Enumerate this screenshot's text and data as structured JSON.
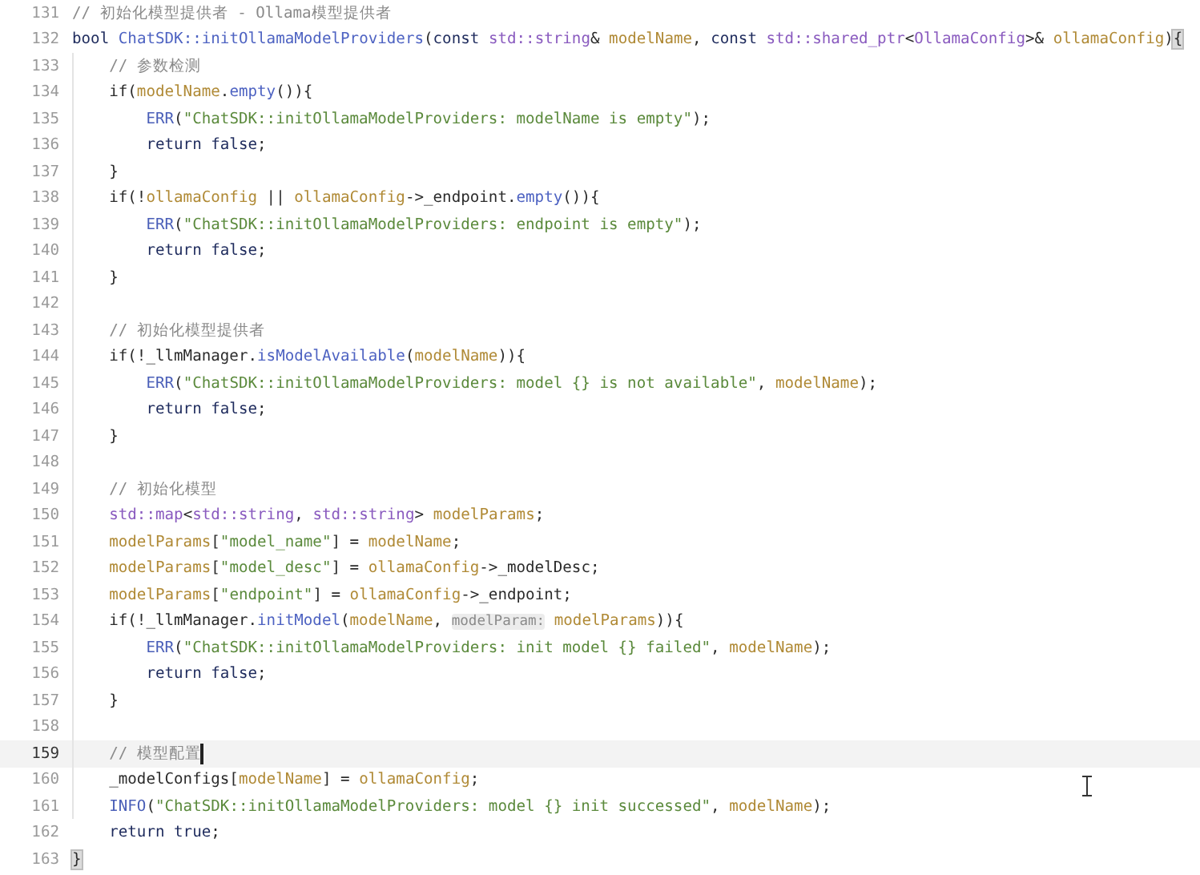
{
  "editor": {
    "lines": [
      {
        "number": "131",
        "current": false,
        "tokens": [
          {
            "kind": "comment",
            "text": "// 初始化模型提供者 - Ollama模型提供者"
          }
        ]
      },
      {
        "number": "132",
        "current": false,
        "tokens": [
          {
            "kind": "keyword",
            "text": "bool "
          },
          {
            "kind": "function",
            "text": "ChatSDK::initOllamaModelProviders"
          },
          {
            "kind": "plain",
            "text": "("
          },
          {
            "kind": "keyword",
            "text": "const "
          },
          {
            "kind": "type",
            "text": "std::string"
          },
          {
            "kind": "plain",
            "text": "& "
          },
          {
            "kind": "variable",
            "text": "modelName"
          },
          {
            "kind": "plain",
            "text": ", "
          },
          {
            "kind": "keyword",
            "text": "const "
          },
          {
            "kind": "type",
            "text": "std::shared_ptr"
          },
          {
            "kind": "plain",
            "text": "<"
          },
          {
            "kind": "type",
            "text": "OllamaConfig"
          },
          {
            "kind": "plain",
            "text": ">& "
          },
          {
            "kind": "variable",
            "text": "ollamaConfig"
          },
          {
            "kind": "plain",
            "text": ")"
          },
          {
            "kind": "match",
            "text": "{"
          }
        ]
      },
      {
        "number": "133",
        "current": false,
        "tokens": [
          {
            "kind": "comment",
            "text": "    // 参数检测"
          }
        ]
      },
      {
        "number": "134",
        "current": false,
        "tokens": [
          {
            "kind": "plain",
            "text": "    if("
          },
          {
            "kind": "variable",
            "text": "modelName"
          },
          {
            "kind": "plain",
            "text": "."
          },
          {
            "kind": "function",
            "text": "empty"
          },
          {
            "kind": "plain",
            "text": "()){"
          }
        ]
      },
      {
        "number": "135",
        "current": false,
        "tokens": [
          {
            "kind": "macro",
            "text": "        ERR"
          },
          {
            "kind": "plain",
            "text": "("
          },
          {
            "kind": "string",
            "text": "\"ChatSDK::initOllamaModelProviders: modelName is empty\""
          },
          {
            "kind": "plain",
            "text": ");"
          }
        ]
      },
      {
        "number": "136",
        "current": false,
        "tokens": [
          {
            "kind": "keyword",
            "text": "        return false"
          },
          {
            "kind": "plain",
            "text": ";"
          }
        ]
      },
      {
        "number": "137",
        "current": false,
        "tokens": [
          {
            "kind": "plain",
            "text": "    }"
          }
        ]
      },
      {
        "number": "138",
        "current": false,
        "tokens": [
          {
            "kind": "plain",
            "text": "    if(!"
          },
          {
            "kind": "variable",
            "text": "ollamaConfig"
          },
          {
            "kind": "plain",
            "text": " || "
          },
          {
            "kind": "variable",
            "text": "ollamaConfig"
          },
          {
            "kind": "plain",
            "text": "->_endpoint."
          },
          {
            "kind": "function",
            "text": "empty"
          },
          {
            "kind": "plain",
            "text": "()){"
          }
        ]
      },
      {
        "number": "139",
        "current": false,
        "tokens": [
          {
            "kind": "macro",
            "text": "        ERR"
          },
          {
            "kind": "plain",
            "text": "("
          },
          {
            "kind": "string",
            "text": "\"ChatSDK::initOllamaModelProviders: endpoint is empty\""
          },
          {
            "kind": "plain",
            "text": ");"
          }
        ]
      },
      {
        "number": "140",
        "current": false,
        "tokens": [
          {
            "kind": "keyword",
            "text": "        return false"
          },
          {
            "kind": "plain",
            "text": ";"
          }
        ]
      },
      {
        "number": "141",
        "current": false,
        "tokens": [
          {
            "kind": "plain",
            "text": "    }"
          }
        ]
      },
      {
        "number": "142",
        "current": false
      },
      {
        "number": "143",
        "current": false,
        "tokens": [
          {
            "kind": "comment",
            "text": "    // 初始化模型提供者"
          }
        ]
      },
      {
        "number": "144",
        "current": false,
        "tokens": [
          {
            "kind": "plain",
            "text": "    if(!_llmManager."
          },
          {
            "kind": "function",
            "text": "isModelAvailable"
          },
          {
            "kind": "plain",
            "text": "("
          },
          {
            "kind": "variable",
            "text": "modelName"
          },
          {
            "kind": "plain",
            "text": ")){"
          }
        ]
      },
      {
        "number": "145",
        "current": false,
        "tokens": [
          {
            "kind": "macro",
            "text": "        ERR"
          },
          {
            "kind": "plain",
            "text": "("
          },
          {
            "kind": "string",
            "text": "\"ChatSDK::initOllamaModelProviders: model {} is not available\""
          },
          {
            "kind": "plain",
            "text": ", "
          },
          {
            "kind": "variable",
            "text": "modelName"
          },
          {
            "kind": "plain",
            "text": ");"
          }
        ]
      },
      {
        "number": "146",
        "current": false,
        "tokens": [
          {
            "kind": "keyword",
            "text": "        return false"
          },
          {
            "kind": "plain",
            "text": ";"
          }
        ]
      },
      {
        "number": "147",
        "current": false,
        "tokens": [
          {
            "kind": "plain",
            "text": "    }"
          }
        ]
      },
      {
        "number": "148",
        "current": false
      },
      {
        "number": "149",
        "current": false,
        "tokens": [
          {
            "kind": "comment",
            "text": "    // 初始化模型"
          }
        ]
      },
      {
        "number": "150",
        "current": false,
        "tokens": [
          {
            "kind": "type",
            "text": "    std::map"
          },
          {
            "kind": "plain",
            "text": "<"
          },
          {
            "kind": "type",
            "text": "std::string"
          },
          {
            "kind": "plain",
            "text": ", "
          },
          {
            "kind": "type",
            "text": "std::string"
          },
          {
            "kind": "plain",
            "text": "> "
          },
          {
            "kind": "variable",
            "text": "modelParams"
          },
          {
            "kind": "plain",
            "text": ";"
          }
        ]
      },
      {
        "number": "151",
        "current": false,
        "tokens": [
          {
            "kind": "variable",
            "text": "    modelParams"
          },
          {
            "kind": "plain",
            "text": "["
          },
          {
            "kind": "string",
            "text": "\"model_name\""
          },
          {
            "kind": "plain",
            "text": "] = "
          },
          {
            "kind": "variable",
            "text": "modelName"
          },
          {
            "kind": "plain",
            "text": ";"
          }
        ]
      },
      {
        "number": "152",
        "current": false,
        "tokens": [
          {
            "kind": "variable",
            "text": "    modelParams"
          },
          {
            "kind": "plain",
            "text": "["
          },
          {
            "kind": "string",
            "text": "\"model_desc\""
          },
          {
            "kind": "plain",
            "text": "] = "
          },
          {
            "kind": "variable",
            "text": "ollamaConfig"
          },
          {
            "kind": "plain",
            "text": "->_modelDesc;"
          }
        ]
      },
      {
        "number": "153",
        "current": false,
        "tokens": [
          {
            "kind": "variable",
            "text": "    modelParams"
          },
          {
            "kind": "plain",
            "text": "["
          },
          {
            "kind": "string",
            "text": "\"endpoint\""
          },
          {
            "kind": "plain",
            "text": "] = "
          },
          {
            "kind": "variable",
            "text": "ollamaConfig"
          },
          {
            "kind": "plain",
            "text": "->_endpoint;"
          }
        ]
      },
      {
        "number": "154",
        "current": false,
        "tokens": [
          {
            "kind": "plain",
            "text": "    if(!_llmManager."
          },
          {
            "kind": "function",
            "text": "initModel"
          },
          {
            "kind": "plain",
            "text": "("
          },
          {
            "kind": "variable",
            "text": "modelName"
          },
          {
            "kind": "plain",
            "text": ", "
          },
          {
            "kind": "hint",
            "text": "modelParam:"
          },
          {
            "kind": "variable",
            "text": " modelParams"
          },
          {
            "kind": "plain",
            "text": ")){"
          }
        ]
      },
      {
        "number": "155",
        "current": false,
        "tokens": [
          {
            "kind": "macro",
            "text": "        ERR"
          },
          {
            "kind": "plain",
            "text": "("
          },
          {
            "kind": "string",
            "text": "\"ChatSDK::initOllamaModelProviders: init model {} failed\""
          },
          {
            "kind": "plain",
            "text": ", "
          },
          {
            "kind": "variable",
            "text": "modelName"
          },
          {
            "kind": "plain",
            "text": ");"
          }
        ]
      },
      {
        "number": "156",
        "current": false,
        "tokens": [
          {
            "kind": "keyword",
            "text": "        return false"
          },
          {
            "kind": "plain",
            "text": ";"
          }
        ]
      },
      {
        "number": "157",
        "current": false,
        "tokens": [
          {
            "kind": "plain",
            "text": "    }"
          }
        ]
      },
      {
        "number": "158",
        "current": false
      },
      {
        "number": "159",
        "current": true,
        "tokens": [
          {
            "kind": "comment",
            "text": "    // 模型配置"
          }
        ]
      },
      {
        "number": "160",
        "current": false,
        "tokens": [
          {
            "kind": "plain",
            "text": "    _modelConfigs["
          },
          {
            "kind": "variable",
            "text": "modelName"
          },
          {
            "kind": "plain",
            "text": "] = "
          },
          {
            "kind": "variable",
            "text": "ollamaConfig"
          },
          {
            "kind": "plain",
            "text": ";"
          }
        ]
      },
      {
        "number": "161",
        "current": false,
        "tokens": [
          {
            "kind": "macro",
            "text": "    INFO"
          },
          {
            "kind": "plain",
            "text": "("
          },
          {
            "kind": "string",
            "text": "\"ChatSDK::initOllamaModelProviders: model {} init successed\""
          },
          {
            "kind": "plain",
            "text": ", "
          },
          {
            "kind": "variable",
            "text": "modelName"
          },
          {
            "kind": "plain",
            "text": ");"
          }
        ]
      },
      {
        "number": "162",
        "current": false,
        "tokens": [
          {
            "kind": "keyword",
            "text": "    return true"
          },
          {
            "kind": "plain",
            "text": ";"
          }
        ]
      },
      {
        "number": "163",
        "current": false,
        "tokens": [
          {
            "kind": "match",
            "text": "}"
          }
        ]
      }
    ]
  }
}
